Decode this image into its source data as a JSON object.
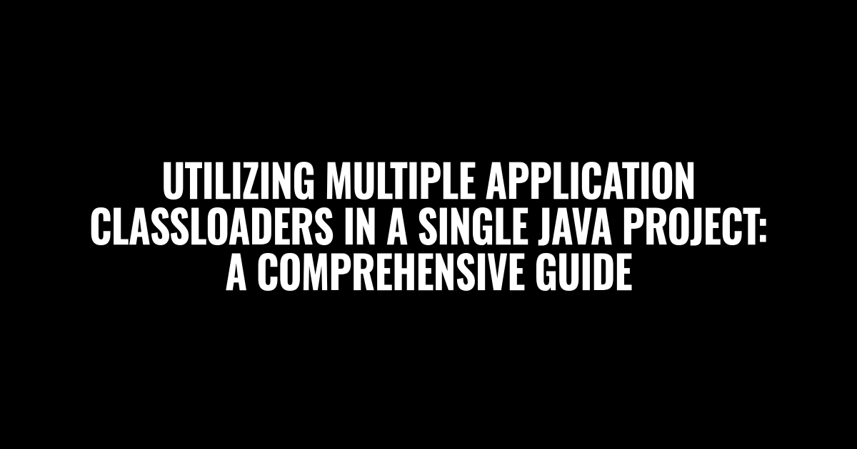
{
  "title": "UTILIZING MULTIPLE APPLICATION CLASSLOADERS IN A SINGLE JAVA PROJECT: A COMPREHENSIVE GUIDE"
}
